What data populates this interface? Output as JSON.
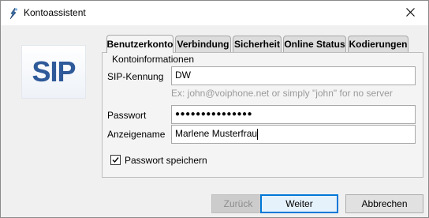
{
  "window": {
    "title": "Kontoassistent"
  },
  "logo": {
    "text": "SIP",
    "color": "#2f5a99"
  },
  "tabs": [
    {
      "label": "Benutzerkonto",
      "active": true
    },
    {
      "label": "Verbindung",
      "active": false
    },
    {
      "label": "Sicherheit",
      "active": false
    },
    {
      "label": "Online Status",
      "active": false
    },
    {
      "label": "Kodierungen",
      "active": false
    }
  ],
  "account": {
    "group_title": "Kontoinformationen",
    "sip_label": "SIP-Kennung",
    "sip_value": "DW",
    "sip_hint": "Ex: john@voiphone.net or simply \"john\" for no server",
    "password_label": "Passwort",
    "password_value": "●●●●●●●●●●●●●●●",
    "display_label": "Anzeigename",
    "display_value": "Marlene Musterfrau",
    "save_password_label": "Passwort speichern",
    "save_password_checked": true
  },
  "buttons": {
    "back": "Zurück",
    "next": "Weiter",
    "cancel": "Abbrechen"
  },
  "colors": {
    "accent": "#0078d7",
    "titlebar": "#ffffff",
    "background": "#f0f0f0"
  }
}
